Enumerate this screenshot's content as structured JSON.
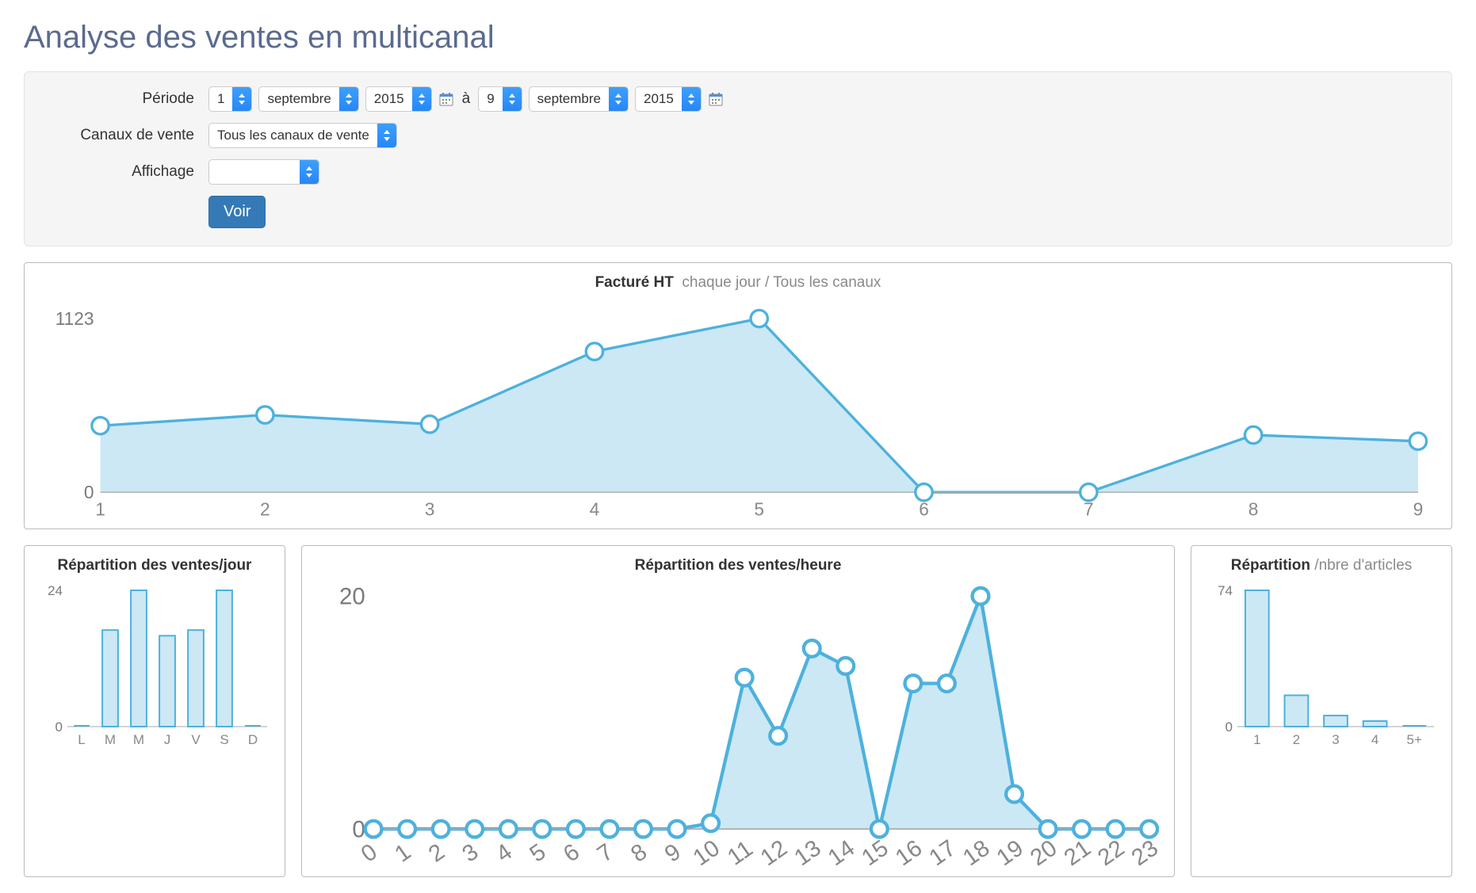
{
  "page_title": "Analyse des ventes en multicanal",
  "filters": {
    "period_label": "Période",
    "period_to": "à",
    "from_day": "1",
    "from_month": "septembre",
    "from_year": "2015",
    "to_day": "9",
    "to_month": "septembre",
    "to_year": "2015",
    "channels_label": "Canaux de vente",
    "channels_value": "Tous les canaux de vente",
    "display_label": "Affichage",
    "display_value": "",
    "submit_label": "Voir"
  },
  "chart_main": {
    "title_bold": "Facturé HT",
    "title_sub": "chaque jour / Tous les canaux"
  },
  "chart_day_title": "Répartition des ventes/jour",
  "chart_hour_title": "Répartition des ventes/heure",
  "chart_articles_title_bold": "Répartition",
  "chart_articles_title_sub": "/nbre d'articles",
  "chart_data": [
    {
      "id": "main",
      "type": "area",
      "title": "Facturé HT chaque jour / Tous les canaux",
      "xlabel": "",
      "ylabel": "",
      "ylim": [
        0,
        1123
      ],
      "categories": [
        "1",
        "2",
        "3",
        "4",
        "5",
        "6",
        "7",
        "8",
        "9"
      ],
      "values": [
        430,
        500,
        440,
        910,
        1123,
        0,
        0,
        370,
        330
      ]
    },
    {
      "id": "day",
      "type": "bar",
      "title": "Répartition des ventes/jour",
      "xlabel": "",
      "ylabel": "",
      "ylim": [
        0,
        24
      ],
      "categories": [
        "L",
        "M",
        "M",
        "J",
        "V",
        "S",
        "D"
      ],
      "values": [
        0,
        17,
        24,
        16,
        17,
        24,
        0
      ]
    },
    {
      "id": "hour",
      "type": "line",
      "title": "Répartition des ventes/heure",
      "xlabel": "",
      "ylabel": "",
      "ylim": [
        0,
        20
      ],
      "categories": [
        "0",
        "1",
        "2",
        "3",
        "4",
        "5",
        "6",
        "7",
        "8",
        "9",
        "10",
        "11",
        "12",
        "13",
        "14",
        "15",
        "16",
        "17",
        "18",
        "19",
        "20",
        "21",
        "22",
        "23"
      ],
      "values": [
        0,
        0,
        0,
        0,
        0,
        0,
        0,
        0,
        0,
        0,
        0.5,
        13,
        8,
        15.5,
        14,
        0,
        12.5,
        12.5,
        20,
        3,
        0,
        0,
        0,
        0
      ]
    },
    {
      "id": "articles",
      "type": "bar",
      "title": "Répartition /nbre d'articles",
      "xlabel": "",
      "ylabel": "",
      "ylim": [
        0,
        74
      ],
      "categories": [
        "1",
        "2",
        "3",
        "4",
        "5+"
      ],
      "values": [
        74,
        17,
        6,
        3,
        0
      ]
    }
  ]
}
